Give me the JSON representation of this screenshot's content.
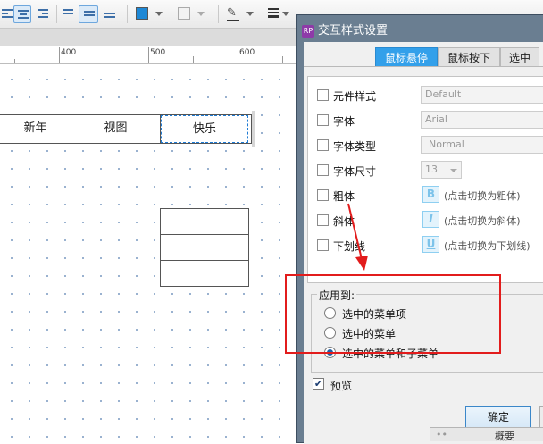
{
  "toolbar": {
    "icons": [
      "align-left-icon",
      "align-center-icon",
      "align-right-icon",
      "valign-top-icon",
      "valign-middle-icon",
      "valign-bottom-icon",
      "fill-color-icon",
      "shadow-icon",
      "line-color-icon",
      "line-weight-icon"
    ],
    "fill_color": "#1e88d6"
  },
  "ruler": {
    "labels": [
      "400",
      "500",
      "600"
    ]
  },
  "canvas": {
    "menu_items": [
      "新年",
      "视图",
      "快乐"
    ],
    "submenu_row_count": 3
  },
  "dialog": {
    "title": "交互样式设置",
    "app_icon": "RP",
    "tabs": [
      "鼠标悬停",
      "鼠标按下",
      "选中"
    ],
    "active_tab": "鼠标悬停",
    "properties": [
      {
        "label": "元件样式",
        "value": "Default",
        "control": "select"
      },
      {
        "label": "字体",
        "value": "Arial",
        "control": "select"
      },
      {
        "label": "字体类型",
        "value": "Normal",
        "control": "select"
      },
      {
        "label": "字体尺寸",
        "value": "13",
        "control": "select"
      },
      {
        "label": "粗体",
        "button": "B",
        "hint": "(点击切换为粗体)"
      },
      {
        "label": "斜体",
        "button": "I",
        "hint": "(点击切换为斜体)"
      },
      {
        "label": "下划线",
        "button": "U",
        "hint": "(点击切换为下划线)"
      }
    ],
    "apply_to": {
      "legend": "应用到:",
      "options": [
        "选中的菜单项",
        "选中的菜单",
        "选中的菜单和子菜单"
      ],
      "selected": "选中的菜单和子菜单"
    },
    "preview": {
      "label": "预览",
      "checked": true
    },
    "ok_button": "确定"
  },
  "outline_panel": {
    "label": "概要"
  },
  "colors": {
    "accent": "#33a0ea",
    "annotation_red": "#e21c1c"
  }
}
